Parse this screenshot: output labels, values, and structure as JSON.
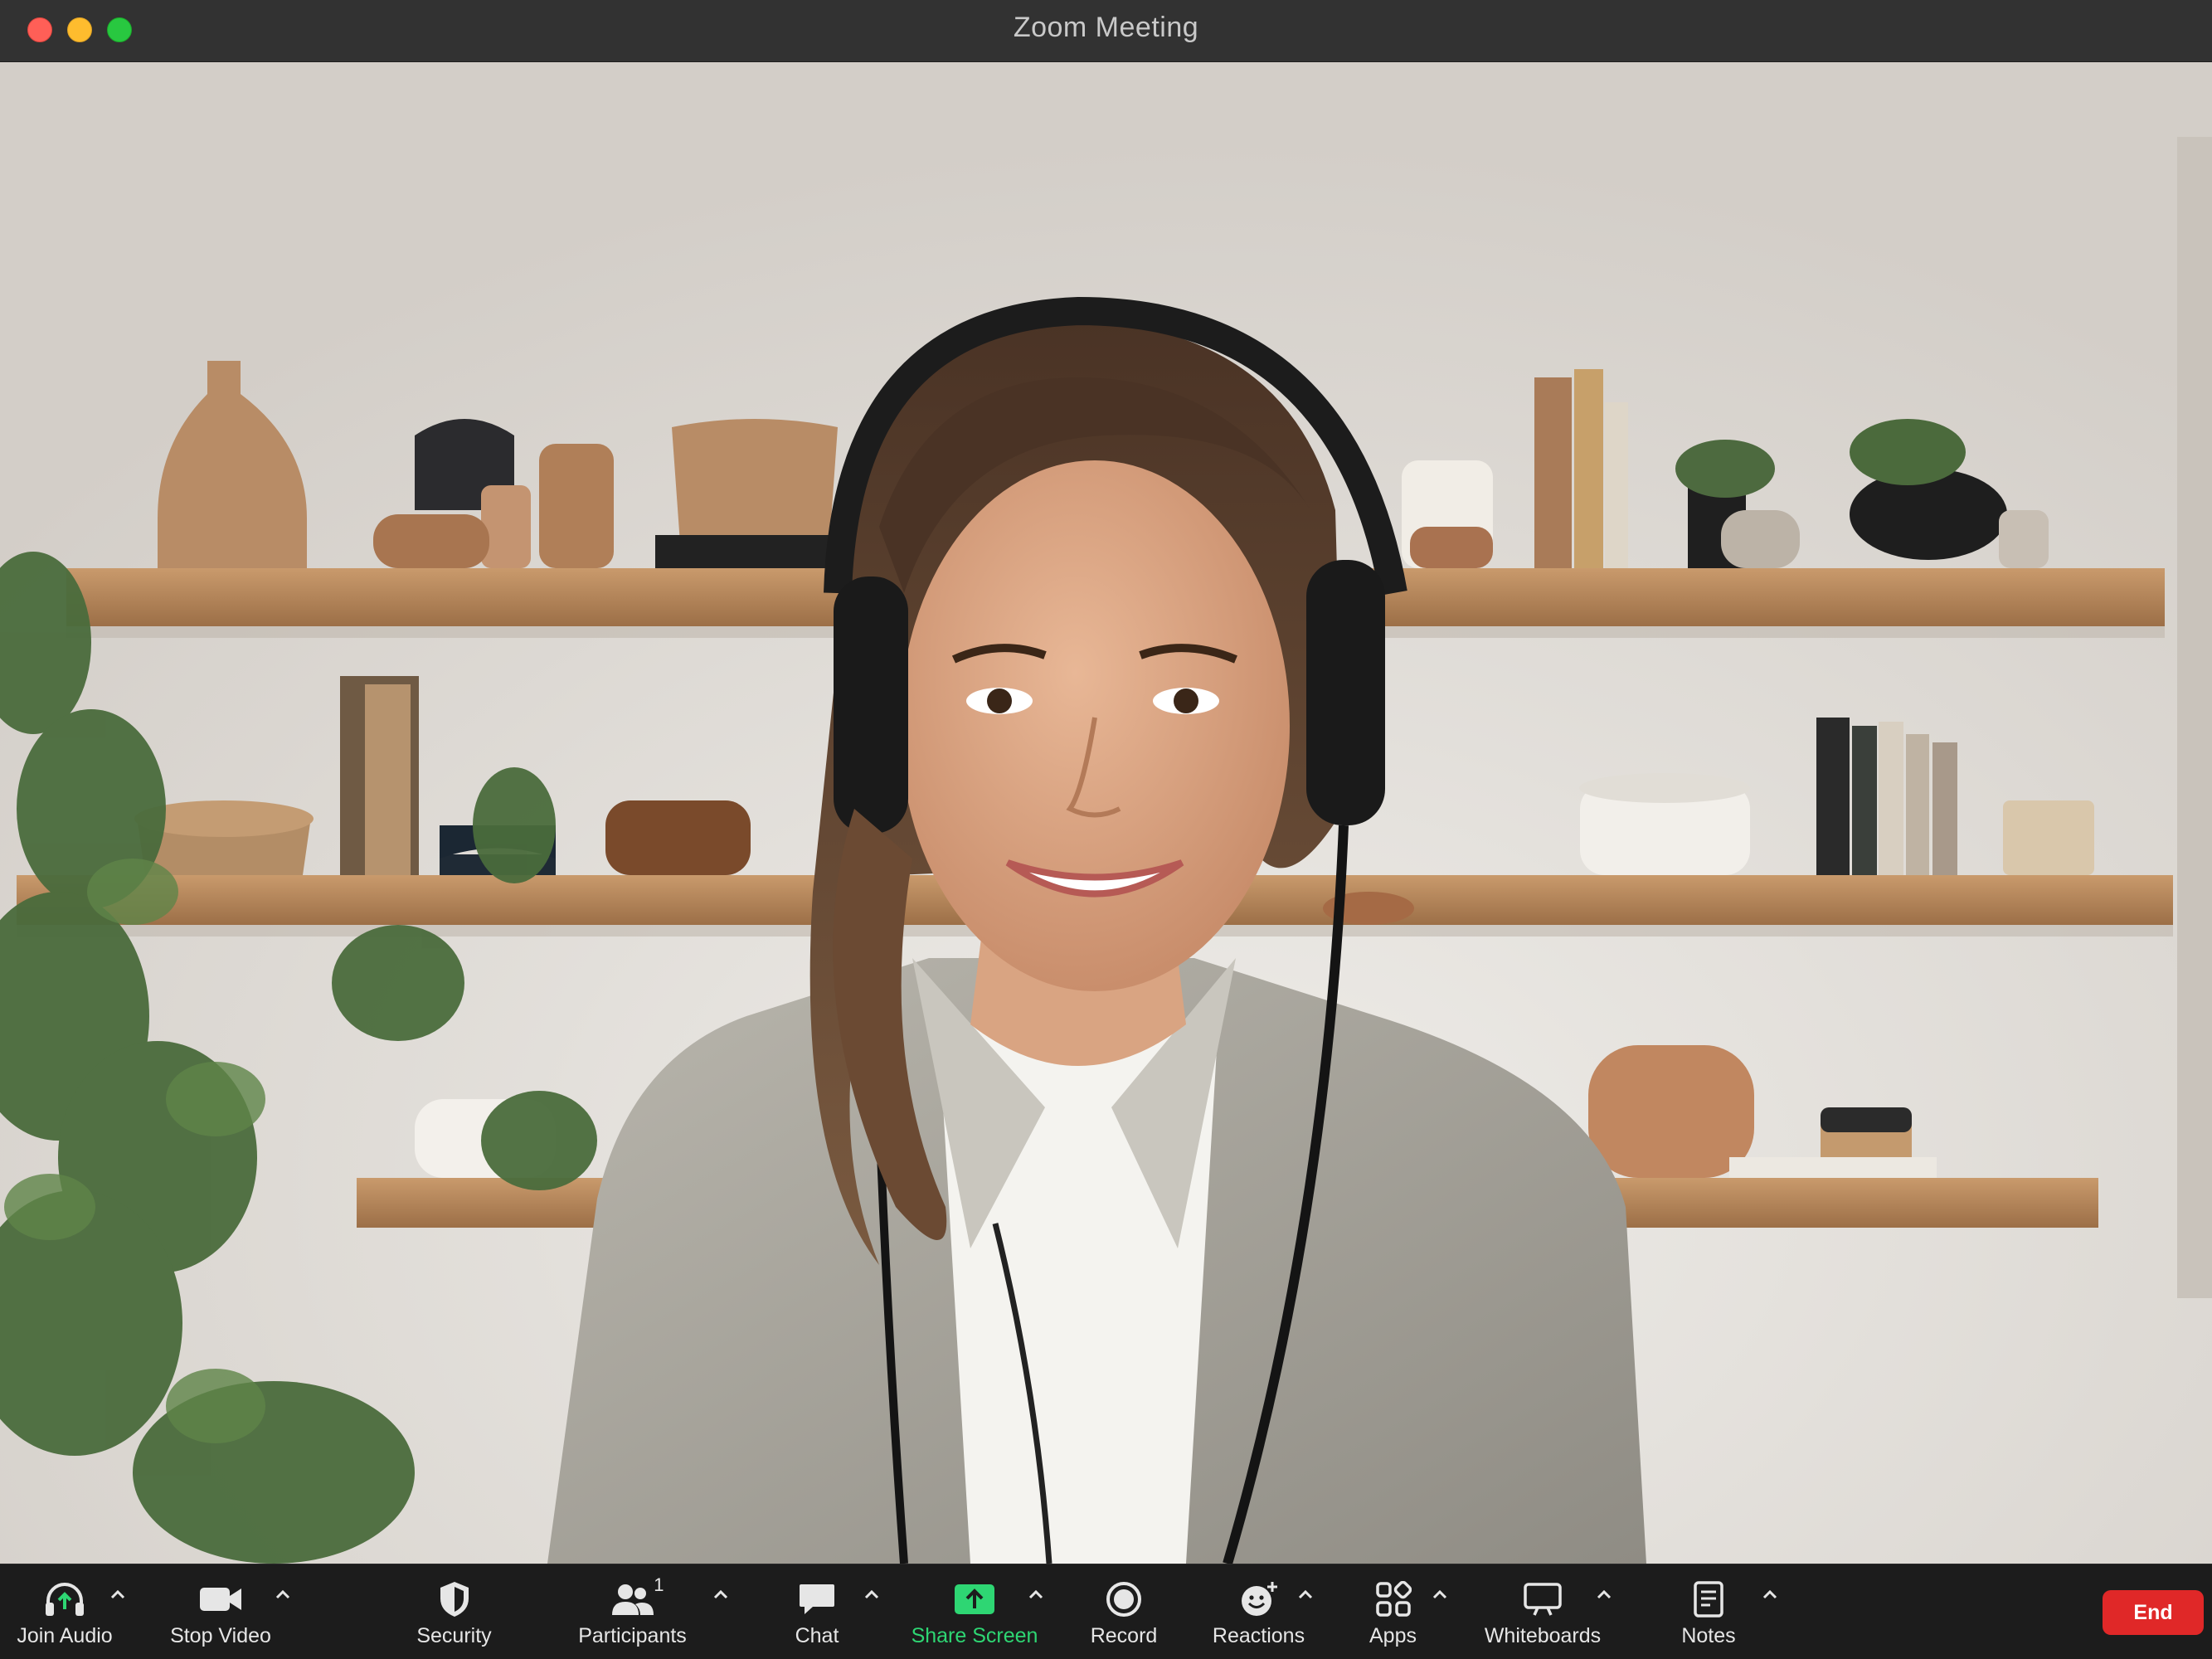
{
  "window": {
    "title": "Zoom Meeting"
  },
  "participants_count": "1",
  "toolbar": {
    "join_audio": "Join Audio",
    "stop_video": "Stop Video",
    "security": "Security",
    "participants": "Participants",
    "chat": "Chat",
    "share_screen": "Share Screen",
    "record": "Record",
    "reactions": "Reactions",
    "apps": "Apps",
    "whiteboards": "Whiteboards",
    "notes": "Notes",
    "end": "End"
  },
  "colors": {
    "share_accent": "#2ed673",
    "end_button": "#e02828",
    "toolbar_bg": "#1c1c1c",
    "titlebar_bg": "#323232"
  }
}
